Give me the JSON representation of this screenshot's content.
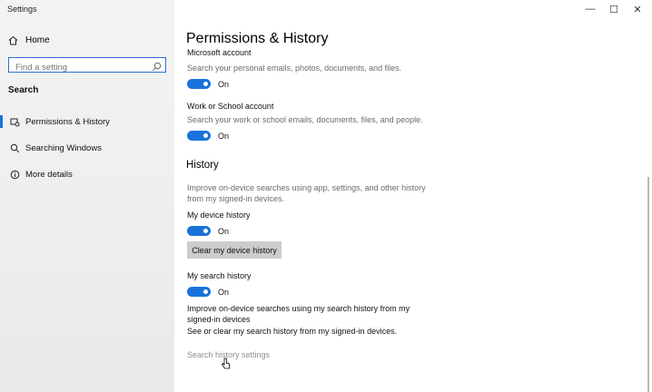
{
  "app": {
    "title": "Settings"
  },
  "window_controls": {
    "minimize": "—",
    "maximize": "☐",
    "close": "✕"
  },
  "sidebar": {
    "home_label": "Home",
    "search_placeholder": "Find a setting",
    "section_label": "Search",
    "items": [
      {
        "label": "Permissions & History",
        "icon": "permissions-icon",
        "active": true
      },
      {
        "label": "Searching Windows",
        "icon": "search-icon",
        "active": false
      },
      {
        "label": "More details",
        "icon": "info-icon",
        "active": false
      }
    ]
  },
  "main": {
    "title": "Permissions & History",
    "microsoft_account": {
      "label": "Microsoft account",
      "description": "Search your personal emails, photos, documents, and files.",
      "toggle_state": "On"
    },
    "work_account": {
      "label": "Work or School account",
      "description": "Search your work or school emails, documents, files, and people.",
      "toggle_state": "On"
    },
    "history": {
      "heading": "History",
      "description_line1": "Improve on-device searches using app, settings, and other history",
      "description_line2": "from my signed-in devices.",
      "device_history_label": "My device history",
      "device_history_state": "On",
      "clear_button": "Clear my device history",
      "search_history_label": "My search history",
      "search_history_state": "On",
      "search_history_desc_line1": "Improve on-device searches using my search history from my",
      "search_history_desc_line2": "signed-in devices",
      "search_history_desc_line3": "See or clear my search history from my signed-in devices.",
      "settings_link": "Search history settings"
    }
  },
  "colors": {
    "accent": "#1a73d9",
    "button_bg": "#cccccc",
    "muted_text": "#6b6b6b"
  }
}
